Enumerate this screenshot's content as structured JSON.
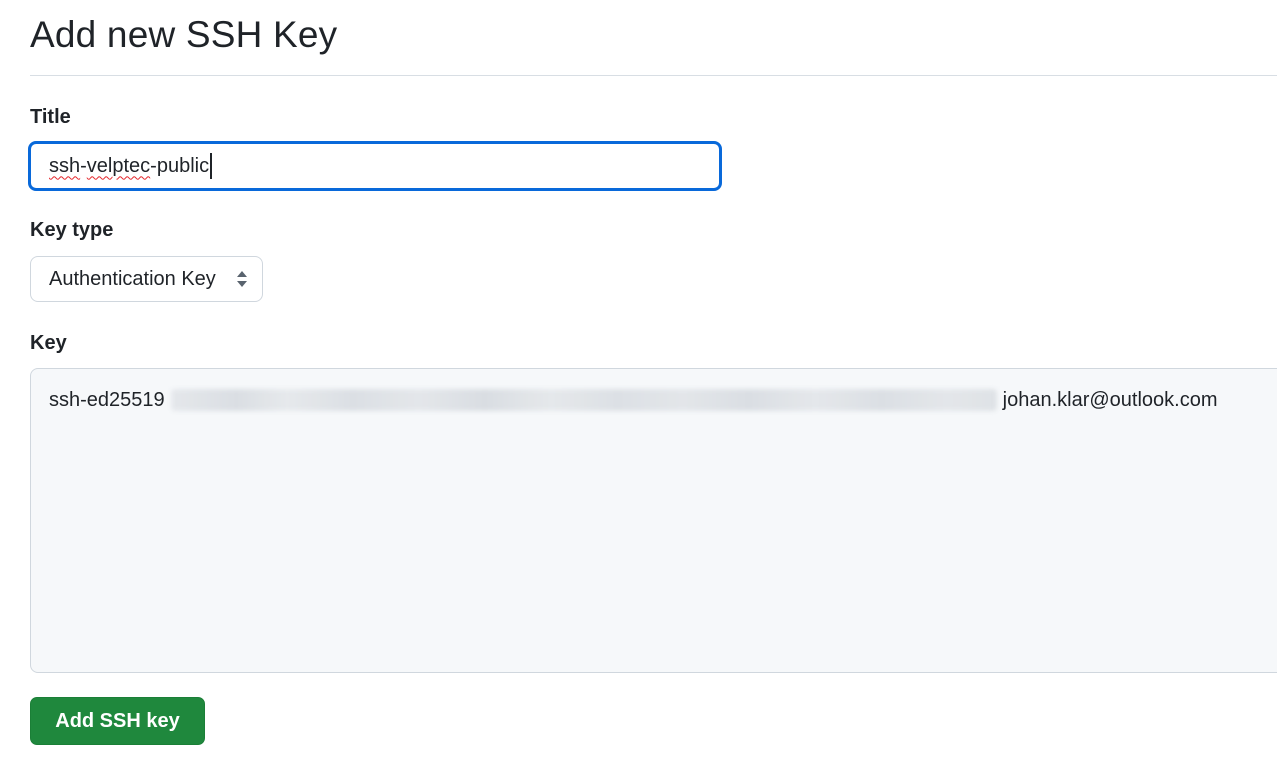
{
  "page": {
    "title": "Add new SSH Key"
  },
  "form": {
    "title_field": {
      "label": "Title",
      "value_part1": "ssh",
      "value_part2": "-",
      "value_part3": "velptec",
      "value_part4": "-public",
      "focus_color": "#0969da"
    },
    "key_type": {
      "label": "Key type",
      "selected": "Authentication Key",
      "icon": "select-arrows-icon"
    },
    "key": {
      "label": "Key",
      "prefix": "ssh-ed25519",
      "suffix": "johan.klar@outlook.com"
    },
    "submit": {
      "label": "Add SSH key",
      "color": "#1f883d"
    }
  }
}
